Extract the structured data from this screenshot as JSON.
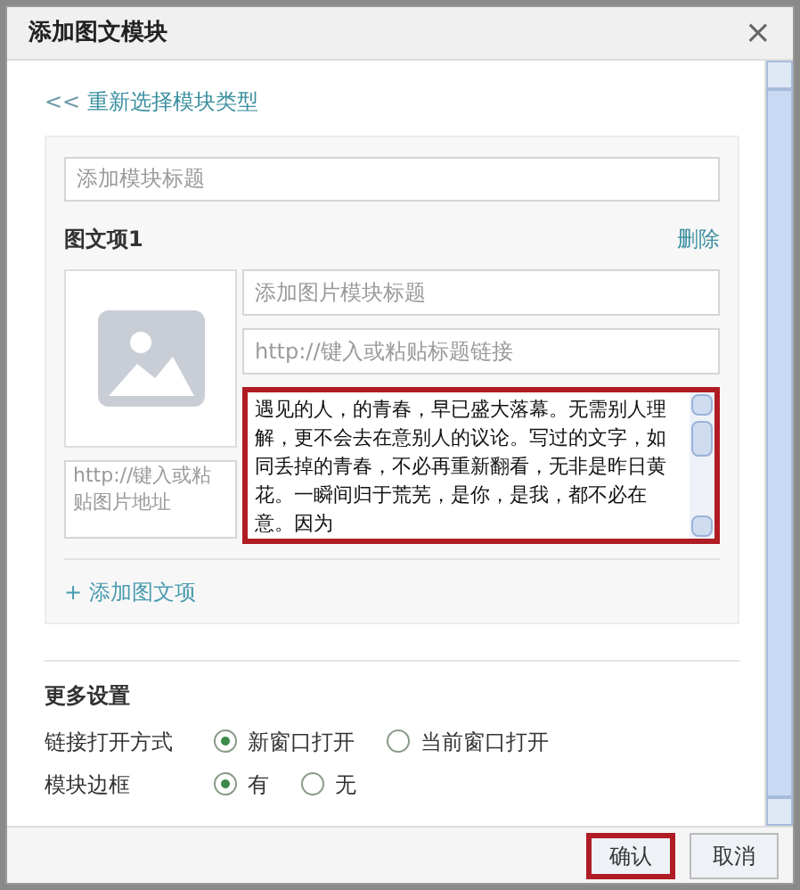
{
  "window": {
    "title": "添加图文模块",
    "close": "×"
  },
  "back_link": {
    "arrows": "<<",
    "label": "重新选择模块类型"
  },
  "module_title": {
    "placeholder": "添加模块标题"
  },
  "item": {
    "heading": "图文项1",
    "delete": "删除",
    "image_url": {
      "placeholder": "http://键入或粘贴图片地址"
    },
    "title": {
      "placeholder": "添加图片模块标题"
    },
    "title_link": {
      "placeholder": "http://键入或粘贴标题链接"
    },
    "body": "遇见的人，的青春，早已盛大落幕。无需别人理解，更不会去在意别人的议论。写过的文字，如同丢掉的青春，不必再重新翻看，无非是昨日黄花。一瞬间归于荒芜，是你，是我，都不必在意。因为",
    "body_highlighted": true
  },
  "add_item": {
    "plus": "+",
    "label": "添加图文项"
  },
  "more_settings": {
    "title": "更多设置",
    "rows": [
      {
        "label": "链接打开方式",
        "options": [
          {
            "label": "新窗口打开",
            "selected": true
          },
          {
            "label": "当前窗口打开",
            "selected": false
          }
        ]
      },
      {
        "label": "模块边框",
        "options": [
          {
            "label": "有",
            "selected": true
          },
          {
            "label": "无",
            "selected": false
          }
        ]
      }
    ]
  },
  "buttons": [
    {
      "label": "确认",
      "highlighted": true
    },
    {
      "label": "取消",
      "highlighted": false
    }
  ]
}
